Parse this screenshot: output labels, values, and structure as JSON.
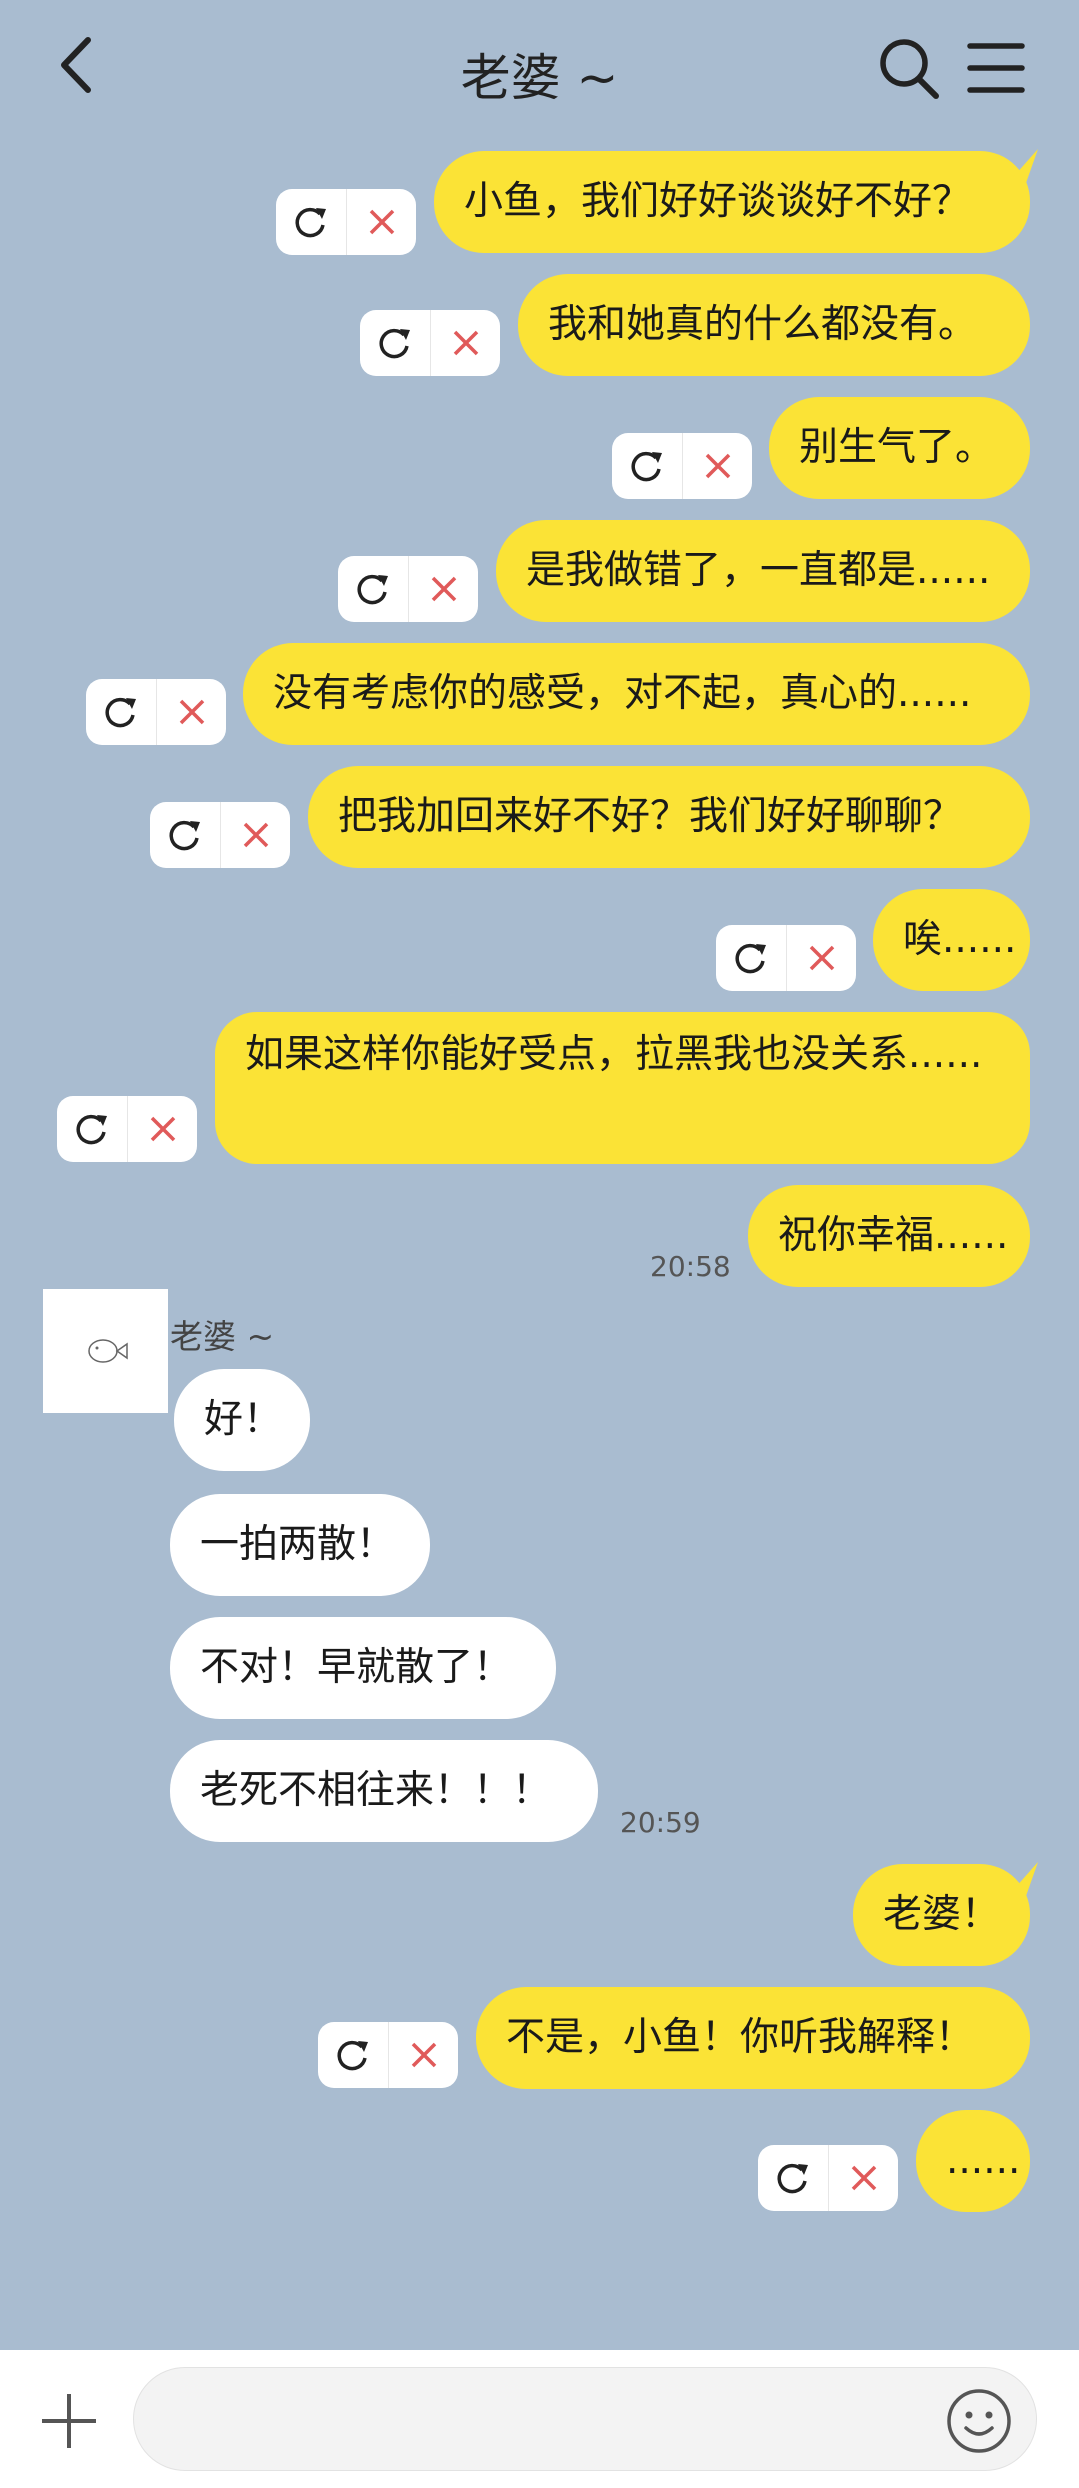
{
  "header": {
    "title": "老婆 ~",
    "icons": [
      "back-icon",
      "search-icon",
      "menu-icon"
    ]
  },
  "messages": [
    {
      "from": "me",
      "text": "小鱼，我们好好谈谈好不好？",
      "failed": true
    },
    {
      "from": "me",
      "text": "我和她真的什么都没有。",
      "failed": true
    },
    {
      "from": "me",
      "text": "别生气了。",
      "failed": true
    },
    {
      "from": "me",
      "text": "是我做错了，一直都是......",
      "failed": true
    },
    {
      "from": "me",
      "text": "没有考虑你的感受，对不起，真心的......",
      "failed": true
    },
    {
      "from": "me",
      "text": "把我加回来好不好？我们好好聊聊？",
      "failed": true
    },
    {
      "from": "me",
      "text": "唉......",
      "failed": true
    },
    {
      "from": "me",
      "text": "如果这样你能好受点，拉黑我也没关系......",
      "failed": true
    },
    {
      "from": "me",
      "text": "祝你幸福......",
      "time": "20:58"
    },
    {
      "from": "other",
      "sender": "老婆 ~",
      "text": "好！"
    },
    {
      "from": "other",
      "text": "一拍两散！"
    },
    {
      "from": "other",
      "text": "不对！早就散了！"
    },
    {
      "from": "other",
      "text": "老死不相往来！！！",
      "time": "20:59"
    },
    {
      "from": "me",
      "text": "老婆！"
    },
    {
      "from": "me",
      "text": "不是，小鱼！你听我解释！",
      "failed": true
    },
    {
      "from": "me",
      "text": "......",
      "failed": true
    }
  ],
  "input": {
    "value": "",
    "placeholder": ""
  },
  "colors": {
    "background": "#a9bcd0",
    "my_bubble": "#fbe336",
    "their_bubble": "#ffffff",
    "delete_x": "#e05a5a"
  }
}
